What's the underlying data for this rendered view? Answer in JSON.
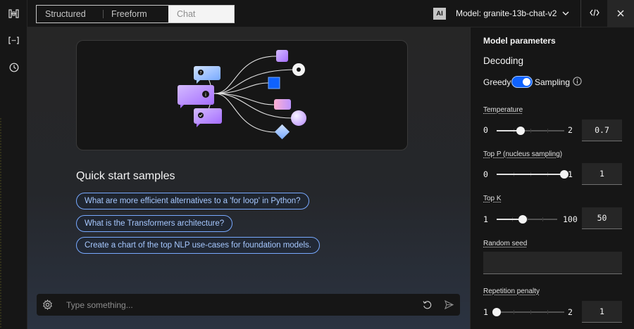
{
  "tabs": [
    "Structured",
    "Freeform",
    "Chat"
  ],
  "header": {
    "ai_badge": "AI",
    "model_label": "Model: granite-13b-chat-v2"
  },
  "main": {
    "quick_start_title": "Quick start samples",
    "samples": [
      "What are more efficient alternatives to a 'for loop' in Python?",
      "What is the Transformers architecture?",
      "Create a chart of the top NLP use-cases for foundation models."
    ],
    "input_placeholder": "Type something..."
  },
  "panel": {
    "title": "Model parameters",
    "decoding_label": "Decoding",
    "greedy_label": "Greedy",
    "sampling_label": "Sampling",
    "decoding_mode": "Sampling",
    "temperature": {
      "label": "Temperature",
      "min": "0",
      "max": "2",
      "value": "0.7",
      "level": 0.35
    },
    "top_p": {
      "label": "Top P (nucleus sampling)",
      "min": "0",
      "max": "1",
      "value": "1",
      "level": 1.0
    },
    "top_k": {
      "label": "Top K",
      "min": "1",
      "max": "100",
      "value": "50",
      "level": 0.43
    },
    "random_seed": {
      "label": "Random seed",
      "value": ""
    },
    "repetition_penalty": {
      "label": "Repetition penalty",
      "min": "1",
      "max": "2",
      "value": "1",
      "level": 0.0
    }
  },
  "colors": {
    "accent_blue": "#0f62fe",
    "sample_border": "#78a9ff",
    "panel_bg": "#161616",
    "main_bg": "#262626"
  },
  "icons": [
    "dashboard-icon",
    "brackets-icon",
    "history-icon",
    "chevron-down-icon",
    "code-icon",
    "close-icon",
    "settings-icon",
    "reset-icon",
    "send-icon",
    "info-icon"
  ]
}
